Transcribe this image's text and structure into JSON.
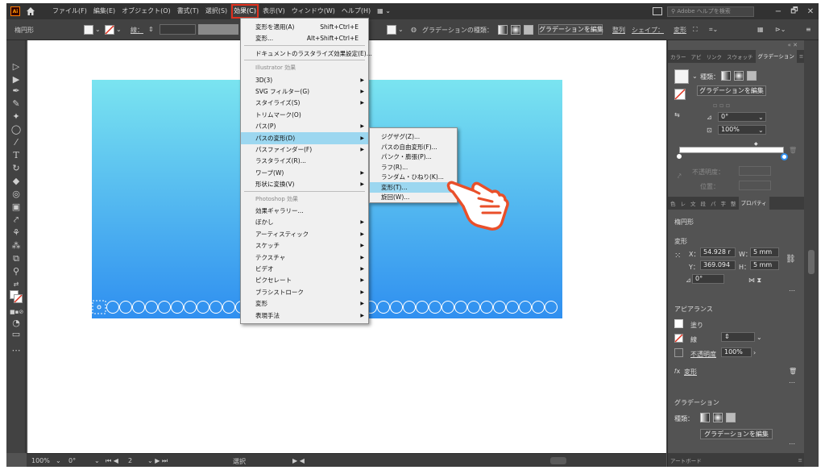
{
  "menubar": {
    "logo": "Ai",
    "items": [
      "ファイル(F)",
      "編集(E)",
      "オブジェクト(O)",
      "書式(T)",
      "選択(S)",
      "効果(C)",
      "表示(V)",
      "ウィンドウ(W)",
      "ヘルプ(H)"
    ],
    "workspace": "▦ ⌄",
    "search_placeholder": "Adobe ヘルプを検索",
    "window_buttons": [
      "−",
      "🗗",
      "✕"
    ]
  },
  "controlbar": {
    "object": "楕円形",
    "stroke_label": "線：",
    "gradient_type_label": "グラデーションの種類：",
    "edit_gradient": "グラデーションを編集",
    "align": "整列",
    "shape": "シェイプ：",
    "transform": "変形"
  },
  "effect_menu": {
    "items": [
      {
        "label": "変形を適用(A)",
        "shortcut": "Shift+Ctrl+E"
      },
      {
        "label": "変形...",
        "shortcut": "Alt+Shift+Ctrl+E"
      },
      {
        "label": "ドキュメントのラスタライズ効果設定(E)..."
      },
      {
        "label": "Illustrator 効果",
        "section": true
      },
      {
        "label": "3D(3)",
        "submenu": true
      },
      {
        "label": "SVG フィルター(G)",
        "submenu": true
      },
      {
        "label": "スタイライズ(S)",
        "submenu": true
      },
      {
        "label": "トリムマーク(O)"
      },
      {
        "label": "パス(P)",
        "submenu": true
      },
      {
        "label": "パスの変形(D)",
        "submenu": true,
        "highlighted": true
      },
      {
        "label": "パスファインダー(F)",
        "submenu": true
      },
      {
        "label": "ラスタライズ(R)..."
      },
      {
        "label": "ワープ(W)",
        "submenu": true
      },
      {
        "label": "形状に変換(V)",
        "submenu": true
      },
      {
        "label": "Photoshop 効果",
        "section": true
      },
      {
        "label": "効果ギャラリー..."
      },
      {
        "label": "ぼかし",
        "submenu": true
      },
      {
        "label": "アーティスティック",
        "submenu": true
      },
      {
        "label": "スケッチ",
        "submenu": true
      },
      {
        "label": "テクスチャ",
        "submenu": true
      },
      {
        "label": "ビデオ",
        "submenu": true
      },
      {
        "label": "ピクセレート",
        "submenu": true
      },
      {
        "label": "ブラシストローク",
        "submenu": true
      },
      {
        "label": "変形",
        "submenu": true
      },
      {
        "label": "表現手法",
        "submenu": true
      }
    ]
  },
  "distort_submenu": {
    "items": [
      {
        "label": "ジグザグ(Z)..."
      },
      {
        "label": "パスの自由変形(F)..."
      },
      {
        "label": "パンク・膨張(P)..."
      },
      {
        "label": "ラフ(R)..."
      },
      {
        "label": "ランダム・ひねり(K)..."
      },
      {
        "label": "変形(T)...",
        "highlighted": true
      },
      {
        "label": "旋回(W)..."
      }
    ]
  },
  "panels": {
    "top_tabs": [
      "カラー",
      "アピ",
      "リンク",
      "スウォッチ",
      "グラデーション"
    ],
    "gradient": {
      "type_label": "種類：",
      "edit_button": "グラデーションを編集",
      "angle": "0°",
      "ratio": "100%",
      "opacity_label": "不透明度：",
      "location_label": "位置："
    },
    "mid_tabs": [
      "色",
      "レ",
      "文",
      "段",
      "パ",
      "字",
      "整",
      "プロパティ"
    ],
    "properties": {
      "object_type": "楕円形",
      "transform_heading": "変形",
      "x_label": "X：",
      "x_value": "54.928 r",
      "y_label": "Y：",
      "y_value": "369.094",
      "w_label": "W：",
      "w_value": "5 mm",
      "h_label": "H：",
      "h_value": "5 mm",
      "rotate": "0°"
    },
    "appearance": {
      "heading": "アピアランス",
      "fill": "塗り",
      "stroke": "線",
      "opacity_label": "不透明度",
      "opacity_value": "100%",
      "effect": "変形"
    },
    "gradient2": {
      "heading": "グラデーション",
      "type_label": "種類：",
      "edit_button": "グラデーションを編集"
    },
    "bottom_tab": "アートボード"
  },
  "statusbar": {
    "zoom": "100%",
    "angle": "0°",
    "artboard": "2",
    "tool": "選択"
  },
  "colors": {
    "highlight": "#9cd7f0",
    "menu_outline": "#e0301e",
    "hand": "#e94f2a",
    "gradient_top": "#7ae4f0",
    "gradient_bottom": "#2f8ff0"
  }
}
